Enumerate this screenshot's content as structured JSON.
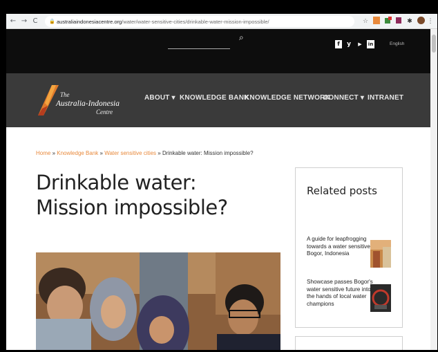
{
  "browser": {
    "url_domain": "australiaindonesiacentre.org",
    "url_path": "/water/water-sensitive-cities/drinkable-water-mission-impossible/"
  },
  "topbar": {
    "social": [
      "f",
      "y",
      "▶",
      "in"
    ],
    "language": "English"
  },
  "logo": {
    "line1": "The",
    "line2": "Australia-Indonesia",
    "line3": "Centre"
  },
  "nav": {
    "items": [
      "ABOUT ▾",
      "KNOWLEDGE BANK",
      "KNOWLEDGE NETWORK",
      "CONNECT ▾",
      "INTRANET"
    ]
  },
  "breadcrumb": {
    "home": "Home",
    "sep": " » ",
    "knowledge_bank": "Knowledge Bank",
    "water": "Water sensitive cities",
    "current": "Drinkable water: Mission impossible?"
  },
  "article": {
    "title": "Drinkable water: Mission impossible?"
  },
  "sidebar": {
    "heading": "Related posts",
    "posts": [
      "A guide for leapfrogging towards a water sensitive Bogor, Indonesia",
      "Showcase passes Bogor's water sensitive future into the hands of local water champions"
    ]
  },
  "colors": {
    "accent_orange": "#e8893b",
    "topbar": "#0d0d0d",
    "navbar": "#3a3a3a"
  }
}
